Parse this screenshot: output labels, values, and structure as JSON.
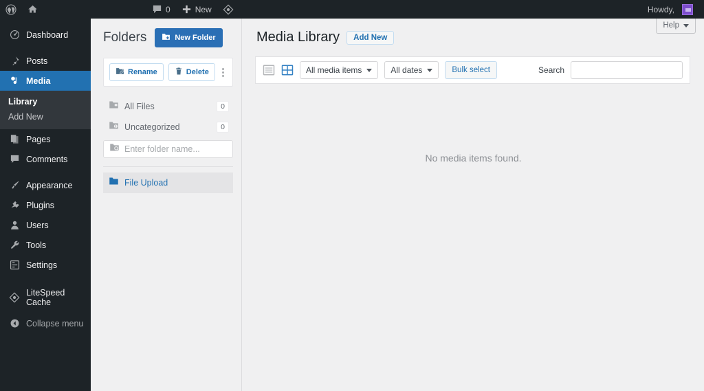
{
  "adminbar": {
    "wp_logo_icon": "wordpress-logo-icon",
    "home_icon": "home-icon",
    "comments_icon": "comment-bubble-icon",
    "comments_count": "0",
    "new_icon": "plus-icon",
    "new_label": "New",
    "performance_icon": "litespeed-diamond-icon",
    "howdy_label": "Howdy,",
    "avatar_icon": "user-avatar"
  },
  "sidebar": {
    "items": [
      {
        "label": "Dashboard",
        "icon": "dashboard-icon",
        "current": false
      },
      {
        "label": "Posts",
        "icon": "pin-icon",
        "current": false
      },
      {
        "label": "Media",
        "icon": "media-icon",
        "current": true
      },
      {
        "label": "Pages",
        "icon": "pages-icon",
        "current": false
      },
      {
        "label": "Comments",
        "icon": "comment-bubble-icon",
        "current": false
      },
      {
        "label": "Appearance",
        "icon": "paintbrush-icon",
        "current": false
      },
      {
        "label": "Plugins",
        "icon": "plug-icon",
        "current": false
      },
      {
        "label": "Users",
        "icon": "user-icon",
        "current": false
      },
      {
        "label": "Tools",
        "icon": "wrench-icon",
        "current": false
      },
      {
        "label": "Settings",
        "icon": "settings-sliders-icon",
        "current": false
      },
      {
        "label": "LiteSpeed Cache",
        "icon": "litespeed-diamond-icon",
        "current": false
      }
    ],
    "submenu": [
      {
        "label": "Library",
        "current": true
      },
      {
        "label": "Add New",
        "current": false
      }
    ],
    "collapse_label": "Collapse menu",
    "collapse_icon": "collapse-arrow-icon"
  },
  "folders": {
    "title": "Folders",
    "new_folder_label": "New Folder",
    "new_folder_icon": "folder-plus-icon",
    "rename_label": "Rename",
    "rename_icon": "folder-pencil-icon",
    "delete_label": "Delete",
    "delete_icon": "trash-icon",
    "kebab_icon": "vertical-dots-icon",
    "rows": [
      {
        "label": "All Files",
        "count": "0",
        "icon": "folder-icon"
      },
      {
        "label": "Uncategorized",
        "count": "0",
        "icon": "folder-info-icon"
      }
    ],
    "search_placeholder": "Enter folder name...",
    "search_value": "",
    "search_icon": "folder-search-icon",
    "selected_folder": {
      "label": "File Upload",
      "icon": "folder-filled-icon"
    }
  },
  "main": {
    "help_label": "Help",
    "help_icon": "chevron-down-icon",
    "page_title": "Media Library",
    "add_new_label": "Add New",
    "list_view_icon": "list-view-icon",
    "grid_view_icon": "grid-view-icon",
    "media_filter": "All media items",
    "date_filter": "All dates",
    "bulk_select_label": "Bulk select",
    "search_label": "Search",
    "search_value": "",
    "empty_message": "No media items found."
  },
  "colors": {
    "admin_bar_bg": "#1d2327",
    "sidebar_bg": "#1d2327",
    "submenu_bg": "#32373c",
    "accent_blue": "#2271b1",
    "button_blue": "#2a6fb5",
    "page_bg": "#f0f0f1",
    "avatar_purple": "#7c4dcc"
  }
}
